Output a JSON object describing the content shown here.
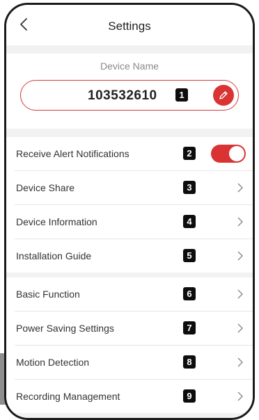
{
  "header": {
    "title": "Settings"
  },
  "device": {
    "label": "Device Name",
    "name": "103532610",
    "badge": "1"
  },
  "alerts_group": [
    {
      "label": "Receive Alert Notifications",
      "badge": "2",
      "control": "toggle",
      "toggle_on": true
    },
    {
      "label": "Device Share",
      "badge": "3",
      "control": "chevron"
    },
    {
      "label": "Device Information",
      "badge": "4",
      "control": "chevron"
    },
    {
      "label": "Installation Guide",
      "badge": "5",
      "control": "chevron"
    }
  ],
  "function_group": [
    {
      "label": "Basic Function",
      "badge": "6",
      "control": "chevron"
    },
    {
      "label": "Power Saving Settings",
      "badge": "7",
      "control": "chevron"
    },
    {
      "label": "Motion Detection",
      "badge": "8",
      "control": "chevron"
    },
    {
      "label": "Recording Management",
      "badge": "9",
      "control": "chevron"
    }
  ],
  "colors": {
    "accent": "#d93333",
    "background": "#f2f2f2"
  },
  "icons": {
    "back": "chevron-left-icon",
    "edit": "pencil-icon",
    "row_action": "chevron-right-icon"
  }
}
